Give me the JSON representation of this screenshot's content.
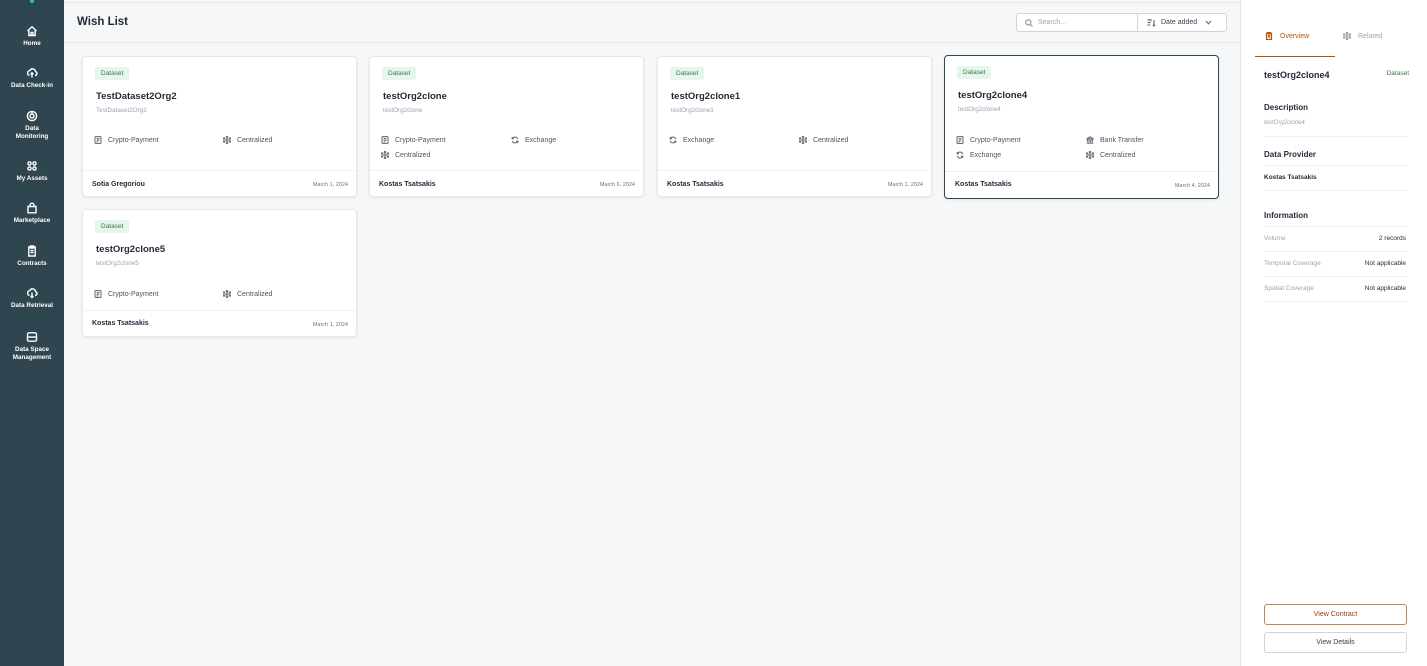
{
  "sidebar": {
    "items": [
      {
        "label": "Home",
        "icon": "home-icon"
      },
      {
        "label": "Data Check-in",
        "icon": "cloud-upload-icon"
      },
      {
        "label": "Data\nMonitoring",
        "icon": "monitoring-icon"
      },
      {
        "label": "My Assets",
        "icon": "grid-icon"
      },
      {
        "label": "Marketplace",
        "icon": "shopping-bag-icon"
      },
      {
        "label": "Contracts",
        "icon": "clipboard-icon"
      },
      {
        "label": "Data Retrieval",
        "icon": "cloud-download-icon"
      },
      {
        "label": "Data Space\nManagement",
        "icon": "database-icon"
      }
    ]
  },
  "header": {
    "title": "Wish List",
    "search_placeholder": "Search...",
    "sort_label": "Date added"
  },
  "cards": [
    {
      "badge": "Dataset",
      "title": "TestDataset2Org2",
      "subtitle": "TestDataset2Org2",
      "features": [
        "Crypto-Payment",
        "Centralized"
      ],
      "author": "Sotia Gregoriou",
      "date": "March 1, 2024"
    },
    {
      "badge": "Dataset",
      "title": "testOrg2clone",
      "subtitle": "testOrg2clone",
      "features": [
        "Crypto-Payment",
        "Exchange",
        "Centralized"
      ],
      "author": "Kostas Tsatsakis",
      "date": "March 6, 2024"
    },
    {
      "badge": "Dataset",
      "title": "testOrg2clone1",
      "subtitle": "testOrg2clone1",
      "features": [
        "Exchange",
        "Centralized"
      ],
      "author": "Kostas Tsatsakis",
      "date": "March 1, 2024"
    },
    {
      "badge": "Dataset",
      "title": "testOrg2clone4",
      "subtitle": "testOrg2clone4",
      "features": [
        "Crypto-Payment",
        "Bank Transfer",
        "Exchange",
        "Centralized"
      ],
      "author": "Kostas Tsatsakis",
      "date": "March 4, 2024"
    },
    {
      "badge": "Dataset",
      "title": "testOrg2clone5",
      "subtitle": "testOrg2clone5",
      "features": [
        "Crypto-Payment",
        "Centralized"
      ],
      "author": "Kostas Tsatsakis",
      "date": "March 1, 2024"
    }
  ],
  "panel": {
    "tabs": [
      "Overview",
      "Related"
    ],
    "title": "testOrg2clone4",
    "badge": "Dataset",
    "description_heading": "Description",
    "description": "testOrg2clone4",
    "provider_heading": "Data Provider",
    "provider": "Kostas Tsatsakis",
    "information_heading": "Information",
    "info": [
      {
        "key": "Volume",
        "value": "2 records"
      },
      {
        "key": "Temporal Coverage",
        "value": "Not applicable"
      },
      {
        "key": "Spatial Coverage",
        "value": "Not applicable"
      }
    ],
    "view_contract": "View Contract",
    "view_details": "View Details"
  },
  "colors": {
    "sidebar": "#2f4550",
    "accent": "#b45309",
    "badge_bg": "#e8f5ec",
    "badge_text": "#2e7d46"
  }
}
